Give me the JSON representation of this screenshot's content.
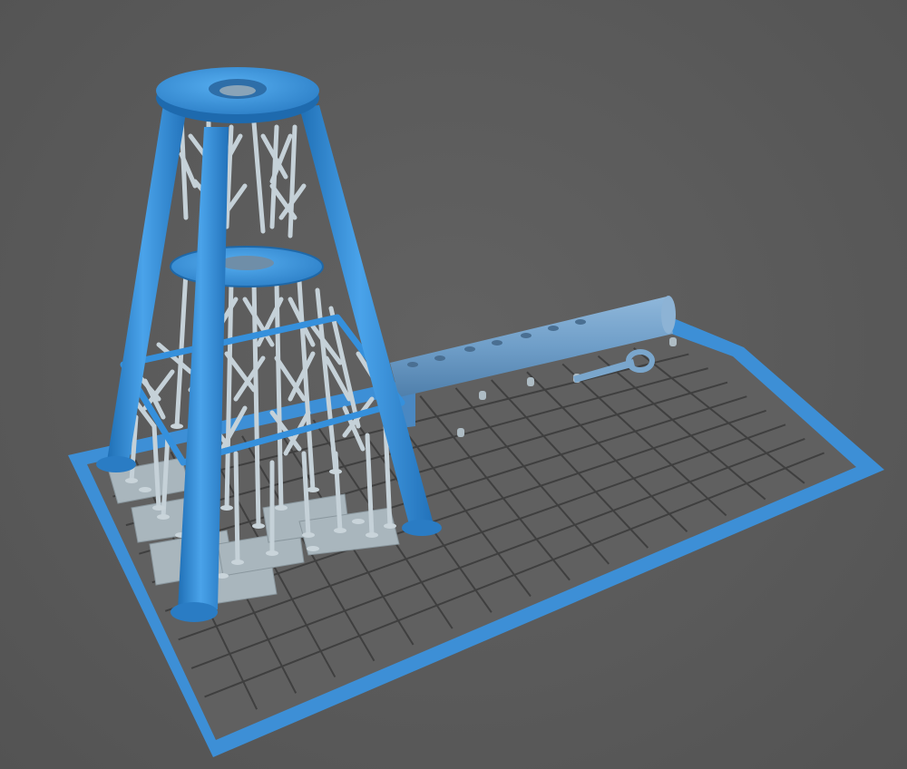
{
  "viewport": {
    "background": "#5a5a5a",
    "plate_fill": "#606060",
    "plate_border": "#3d8fd6",
    "grid_color": "#3e3e3e",
    "model_color": "#3a8fd8",
    "support_color": "#c3cfd6",
    "raft_color": "#a8b5bc"
  },
  "objects": [
    {
      "name": "build-plate",
      "icon": "grid-plate"
    },
    {
      "name": "tower-model",
      "icon": "tower"
    },
    {
      "name": "rod-model",
      "icon": "cylinder"
    },
    {
      "name": "eye-bolt-model",
      "icon": "eye-bolt"
    }
  ]
}
